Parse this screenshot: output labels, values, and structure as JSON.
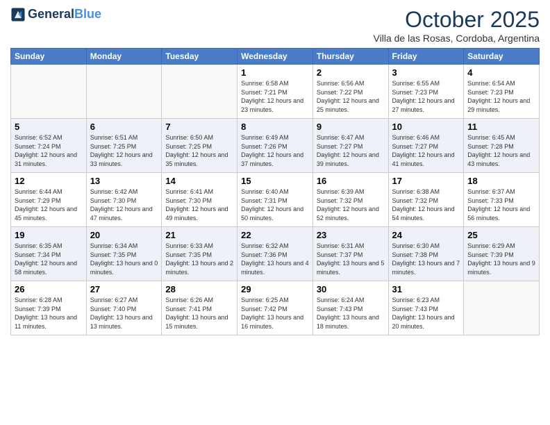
{
  "header": {
    "logo_line1": "General",
    "logo_line2": "Blue",
    "title": "October 2025",
    "subtitle": "Villa de las Rosas, Cordoba, Argentina"
  },
  "days_of_week": [
    "Sunday",
    "Monday",
    "Tuesday",
    "Wednesday",
    "Thursday",
    "Friday",
    "Saturday"
  ],
  "weeks": [
    [
      {
        "day": "",
        "sunrise": "",
        "sunset": "",
        "daylight": ""
      },
      {
        "day": "",
        "sunrise": "",
        "sunset": "",
        "daylight": ""
      },
      {
        "day": "",
        "sunrise": "",
        "sunset": "",
        "daylight": ""
      },
      {
        "day": "1",
        "sunrise": "Sunrise: 6:58 AM",
        "sunset": "Sunset: 7:21 PM",
        "daylight": "Daylight: 12 hours and 23 minutes."
      },
      {
        "day": "2",
        "sunrise": "Sunrise: 6:56 AM",
        "sunset": "Sunset: 7:22 PM",
        "daylight": "Daylight: 12 hours and 25 minutes."
      },
      {
        "day": "3",
        "sunrise": "Sunrise: 6:55 AM",
        "sunset": "Sunset: 7:23 PM",
        "daylight": "Daylight: 12 hours and 27 minutes."
      },
      {
        "day": "4",
        "sunrise": "Sunrise: 6:54 AM",
        "sunset": "Sunset: 7:23 PM",
        "daylight": "Daylight: 12 hours and 29 minutes."
      }
    ],
    [
      {
        "day": "5",
        "sunrise": "Sunrise: 6:52 AM",
        "sunset": "Sunset: 7:24 PM",
        "daylight": "Daylight: 12 hours and 31 minutes."
      },
      {
        "day": "6",
        "sunrise": "Sunrise: 6:51 AM",
        "sunset": "Sunset: 7:25 PM",
        "daylight": "Daylight: 12 hours and 33 minutes."
      },
      {
        "day": "7",
        "sunrise": "Sunrise: 6:50 AM",
        "sunset": "Sunset: 7:25 PM",
        "daylight": "Daylight: 12 hours and 35 minutes."
      },
      {
        "day": "8",
        "sunrise": "Sunrise: 6:49 AM",
        "sunset": "Sunset: 7:26 PM",
        "daylight": "Daylight: 12 hours and 37 minutes."
      },
      {
        "day": "9",
        "sunrise": "Sunrise: 6:47 AM",
        "sunset": "Sunset: 7:27 PM",
        "daylight": "Daylight: 12 hours and 39 minutes."
      },
      {
        "day": "10",
        "sunrise": "Sunrise: 6:46 AM",
        "sunset": "Sunset: 7:27 PM",
        "daylight": "Daylight: 12 hours and 41 minutes."
      },
      {
        "day": "11",
        "sunrise": "Sunrise: 6:45 AM",
        "sunset": "Sunset: 7:28 PM",
        "daylight": "Daylight: 12 hours and 43 minutes."
      }
    ],
    [
      {
        "day": "12",
        "sunrise": "Sunrise: 6:44 AM",
        "sunset": "Sunset: 7:29 PM",
        "daylight": "Daylight: 12 hours and 45 minutes."
      },
      {
        "day": "13",
        "sunrise": "Sunrise: 6:42 AM",
        "sunset": "Sunset: 7:30 PM",
        "daylight": "Daylight: 12 hours and 47 minutes."
      },
      {
        "day": "14",
        "sunrise": "Sunrise: 6:41 AM",
        "sunset": "Sunset: 7:30 PM",
        "daylight": "Daylight: 12 hours and 49 minutes."
      },
      {
        "day": "15",
        "sunrise": "Sunrise: 6:40 AM",
        "sunset": "Sunset: 7:31 PM",
        "daylight": "Daylight: 12 hours and 50 minutes."
      },
      {
        "day": "16",
        "sunrise": "Sunrise: 6:39 AM",
        "sunset": "Sunset: 7:32 PM",
        "daylight": "Daylight: 12 hours and 52 minutes."
      },
      {
        "day": "17",
        "sunrise": "Sunrise: 6:38 AM",
        "sunset": "Sunset: 7:32 PM",
        "daylight": "Daylight: 12 hours and 54 minutes."
      },
      {
        "day": "18",
        "sunrise": "Sunrise: 6:37 AM",
        "sunset": "Sunset: 7:33 PM",
        "daylight": "Daylight: 12 hours and 56 minutes."
      }
    ],
    [
      {
        "day": "19",
        "sunrise": "Sunrise: 6:35 AM",
        "sunset": "Sunset: 7:34 PM",
        "daylight": "Daylight: 12 hours and 58 minutes."
      },
      {
        "day": "20",
        "sunrise": "Sunrise: 6:34 AM",
        "sunset": "Sunset: 7:35 PM",
        "daylight": "Daylight: 13 hours and 0 minutes."
      },
      {
        "day": "21",
        "sunrise": "Sunrise: 6:33 AM",
        "sunset": "Sunset: 7:35 PM",
        "daylight": "Daylight: 13 hours and 2 minutes."
      },
      {
        "day": "22",
        "sunrise": "Sunrise: 6:32 AM",
        "sunset": "Sunset: 7:36 PM",
        "daylight": "Daylight: 13 hours and 4 minutes."
      },
      {
        "day": "23",
        "sunrise": "Sunrise: 6:31 AM",
        "sunset": "Sunset: 7:37 PM",
        "daylight": "Daylight: 13 hours and 5 minutes."
      },
      {
        "day": "24",
        "sunrise": "Sunrise: 6:30 AM",
        "sunset": "Sunset: 7:38 PM",
        "daylight": "Daylight: 13 hours and 7 minutes."
      },
      {
        "day": "25",
        "sunrise": "Sunrise: 6:29 AM",
        "sunset": "Sunset: 7:39 PM",
        "daylight": "Daylight: 13 hours and 9 minutes."
      }
    ],
    [
      {
        "day": "26",
        "sunrise": "Sunrise: 6:28 AM",
        "sunset": "Sunset: 7:39 PM",
        "daylight": "Daylight: 13 hours and 11 minutes."
      },
      {
        "day": "27",
        "sunrise": "Sunrise: 6:27 AM",
        "sunset": "Sunset: 7:40 PM",
        "daylight": "Daylight: 13 hours and 13 minutes."
      },
      {
        "day": "28",
        "sunrise": "Sunrise: 6:26 AM",
        "sunset": "Sunset: 7:41 PM",
        "daylight": "Daylight: 13 hours and 15 minutes."
      },
      {
        "day": "29",
        "sunrise": "Sunrise: 6:25 AM",
        "sunset": "Sunset: 7:42 PM",
        "daylight": "Daylight: 13 hours and 16 minutes."
      },
      {
        "day": "30",
        "sunrise": "Sunrise: 6:24 AM",
        "sunset": "Sunset: 7:43 PM",
        "daylight": "Daylight: 13 hours and 18 minutes."
      },
      {
        "day": "31",
        "sunrise": "Sunrise: 6:23 AM",
        "sunset": "Sunset: 7:43 PM",
        "daylight": "Daylight: 13 hours and 20 minutes."
      },
      {
        "day": "",
        "sunrise": "",
        "sunset": "",
        "daylight": ""
      }
    ]
  ]
}
